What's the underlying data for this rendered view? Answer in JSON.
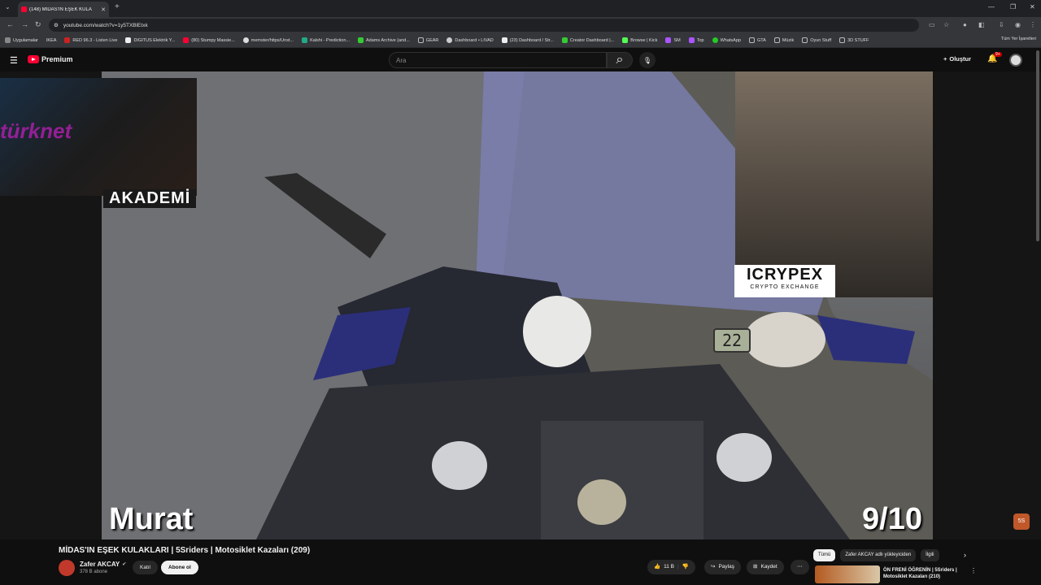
{
  "browser": {
    "tab_title": "(148) MİDAS'IN EŞEK KULA",
    "url": "youtube.com/watch?v=1y5TXBlEtxk",
    "bookmarks": [
      "Uygulamalar",
      "IKEA",
      "RED 96.3 - Listen Live",
      "DIGITUS Elektrik Y...",
      "(80) Stumpy Massie...",
      "memster/https/Unst...",
      "Kalshi - Prediction...",
      "Adams Archive (and...",
      "GEAR",
      "Dashboard • LIVAD",
      "(23) Dashboard / Str...",
      "Creator Dashboard |...",
      "Browse | Kick",
      "SM",
      "Top",
      "WhatsApp",
      "GTA",
      "Müzik",
      "Oyun Stuff",
      "3D STUFF"
    ],
    "bookmarks_other": "Tüm Yer İşaretleri"
  },
  "youtube": {
    "logo_text": "Premium",
    "search_placeholder": "Ara",
    "create_label": "Oluştur",
    "notif_count": "9+"
  },
  "video": {
    "webcam_label": "AKADEMİ",
    "brand_watermark": "türknet",
    "sponsor_name": "ICRYPEX",
    "sponsor_sub": "CRYPTO EXCHANGE",
    "rider_name": "Murat",
    "score": "9/10",
    "speed_display": "22"
  },
  "meta": {
    "title": "MİDAS'IN EŞEK KULAKLARI | 5Sriders | Motosiklet Kazaları (209)",
    "channel_name": "Zafer AKCAY",
    "subscribers": "378 B abone",
    "join_label": "Katıl",
    "subscribe_label": "Abone ol",
    "likes": "11 B",
    "share_label": "Paylaş",
    "save_label": "Kaydet"
  },
  "sidebar": {
    "chips": [
      "Tümü",
      "Zafer AKCAY adlı yükleyiciden",
      "İlgili"
    ],
    "related_title": "ÖN FRENİ ÖĞRENİN | 5Sriders | Motosiklet Kazaları (210)"
  }
}
